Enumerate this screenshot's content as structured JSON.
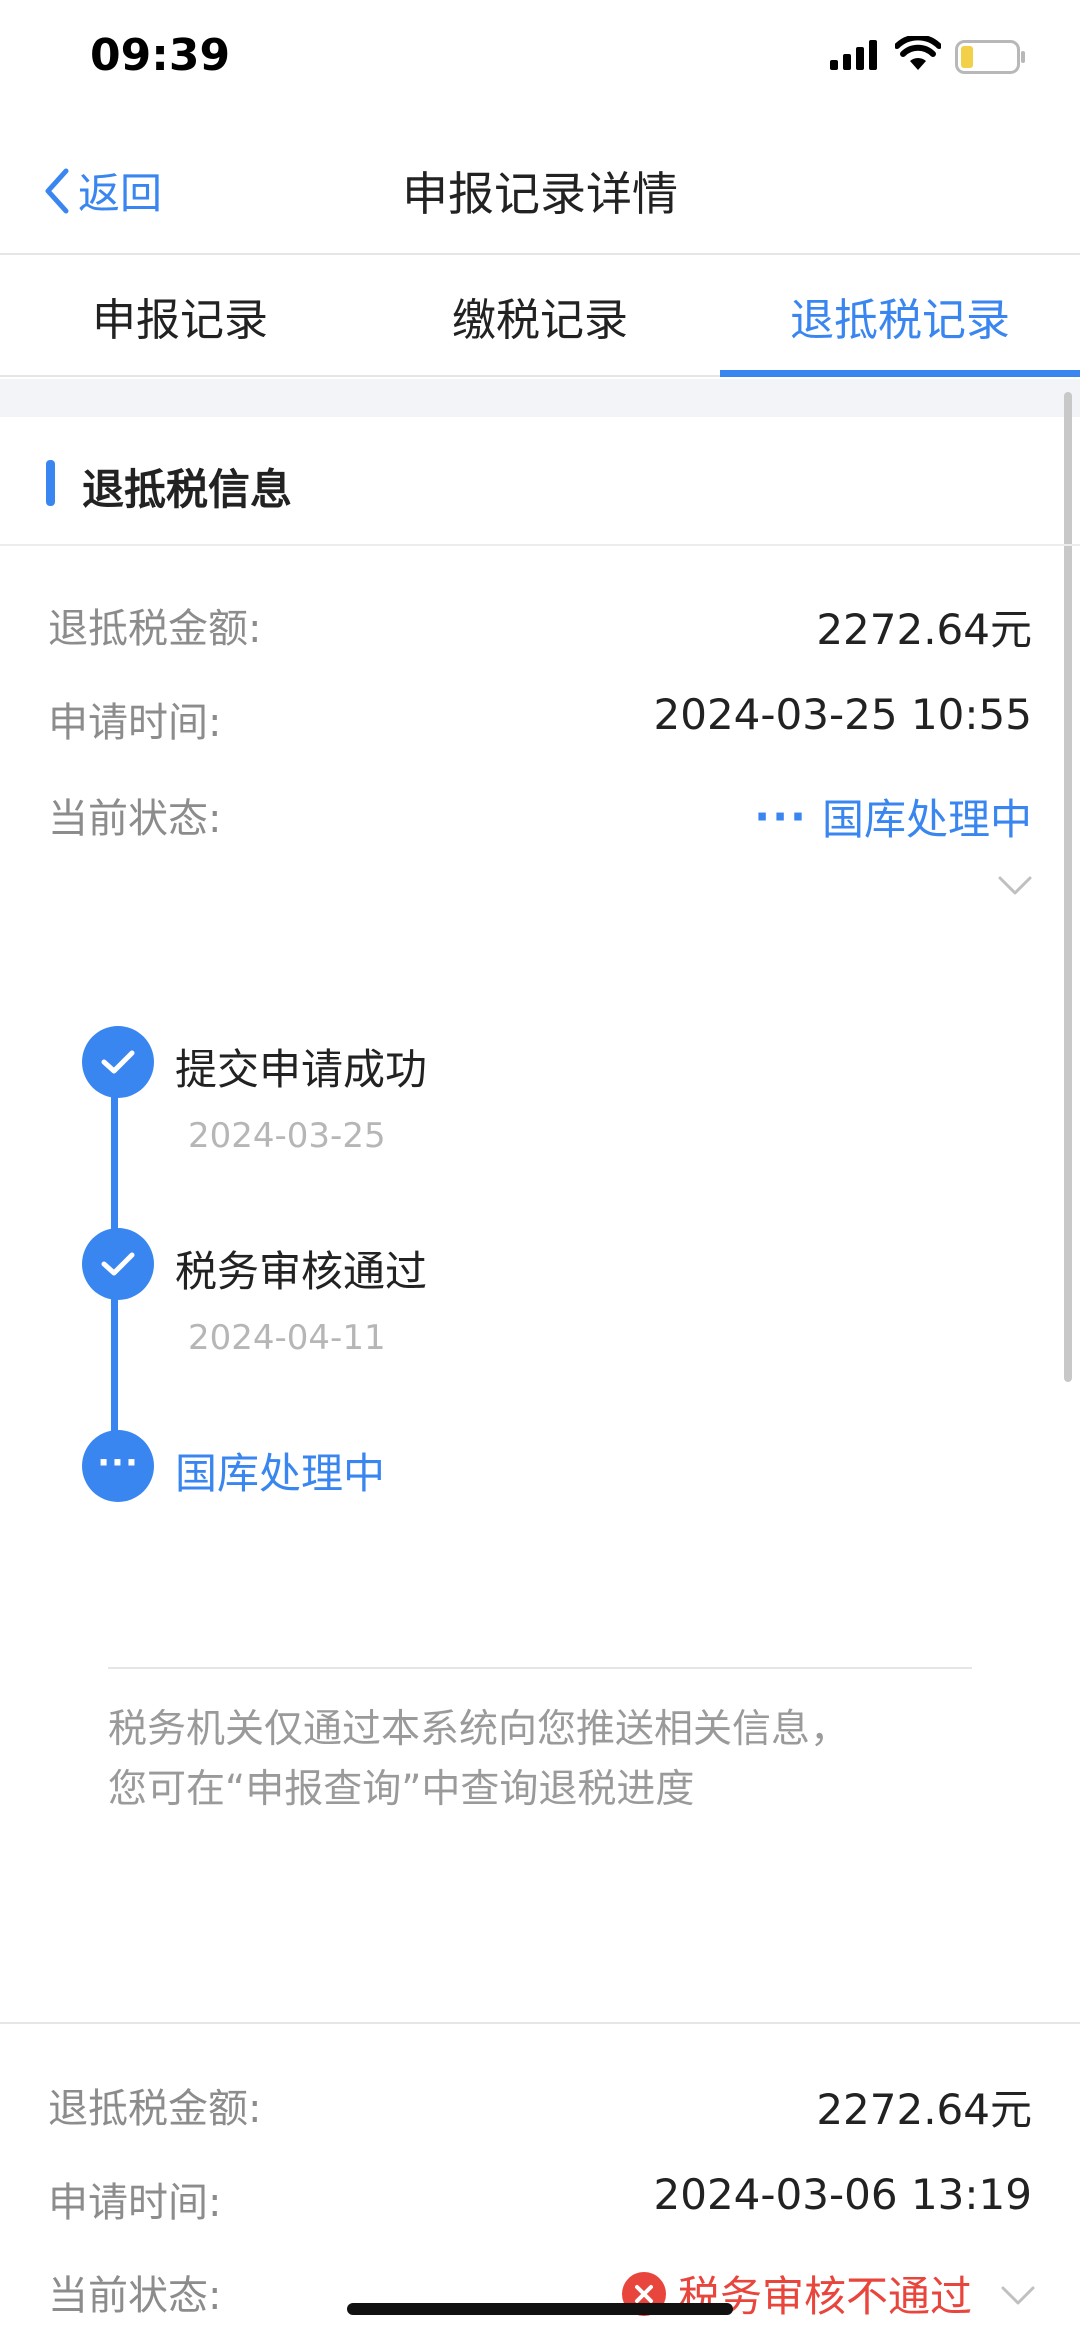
{
  "status_bar": {
    "time": "09:39"
  },
  "nav": {
    "back_label": "返回",
    "title": "申报记录详情"
  },
  "tabs": [
    {
      "label": "申报记录",
      "active": false
    },
    {
      "label": "缴税记录",
      "active": false
    },
    {
      "label": "退抵税记录",
      "active": true
    }
  ],
  "section": {
    "title": "退抵税信息"
  },
  "record1": {
    "amount_label": "退抵税金额:",
    "amount_value": "2272.64元",
    "time_label": "申请时间:",
    "time_value": "2024-03-25 10:55",
    "status_label": "当前状态:",
    "status_dots": "···",
    "status_value": "国库处理中"
  },
  "timeline": [
    {
      "label": "提交申请成功",
      "date": "2024-03-25",
      "state": "done"
    },
    {
      "label": "税务审核通过",
      "date": "2024-04-11",
      "state": "done"
    },
    {
      "label": "国库处理中",
      "date": "",
      "state": "current",
      "dots": "···"
    }
  ],
  "notice": {
    "line1": "税务机关仅通过本系统向您推送相关信息，",
    "line2": "您可在“申报查询”中查询退税进度"
  },
  "record2": {
    "amount_label": "退抵税金额:",
    "amount_value": "2272.64元",
    "time_label": "申请时间:",
    "time_value": "2024-03-06 13:19",
    "status_label": "当前状态:",
    "status_value": "税务审核不通过"
  },
  "colors": {
    "accent": "#3a86f0",
    "error": "#e8453c",
    "muted": "#8c8c8c"
  }
}
